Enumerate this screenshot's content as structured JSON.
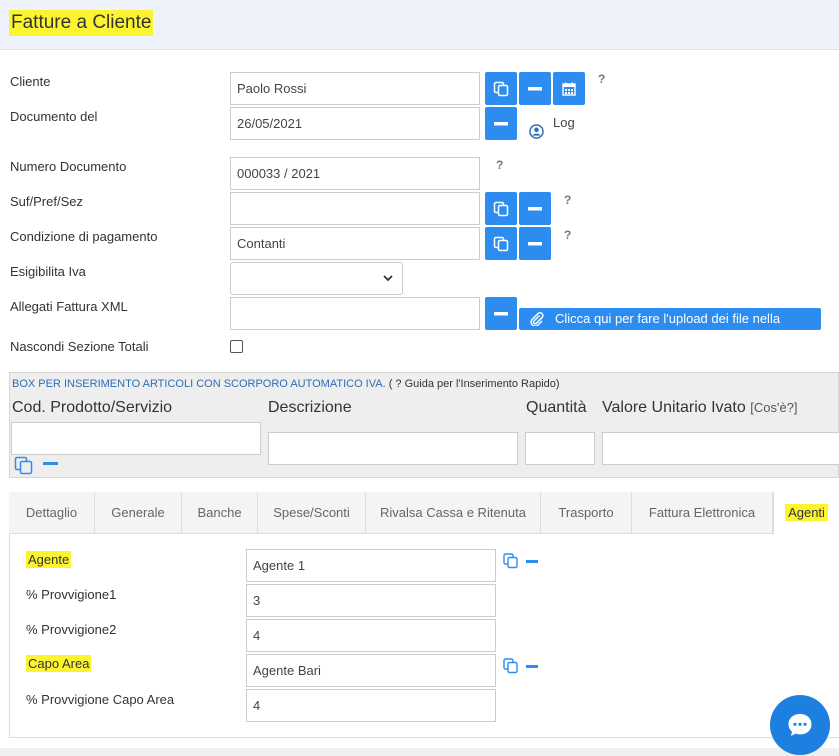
{
  "page_title": "Fatture a Cliente",
  "form": {
    "cliente": {
      "label": "Cliente",
      "value": "Paolo Rossi"
    },
    "documento_del": {
      "label": "Documento del",
      "value": "26/05/2021",
      "log_label": "Log"
    },
    "numero_documento": {
      "label": "Numero Documento",
      "value": "000033 / 2021"
    },
    "suf_pref_sez": {
      "label": "Suf/Pref/Sez",
      "value": ""
    },
    "condizione_pagamento": {
      "label": "Condizione di pagamento",
      "value": "Contanti"
    },
    "esigibilita_iva": {
      "label": "Esigibilita Iva",
      "value": ""
    },
    "allegati_xml": {
      "label": "Allegati Fattura XML",
      "value": "",
      "upload_label": "Clicca qui per fare l'upload dei file nella cartella"
    },
    "nascondi_totali": {
      "label": "Nascondi Sezione Totali",
      "checked": false
    },
    "help_mark": "?"
  },
  "articoli_box": {
    "heading_blue": "BOX PER INSERIMENTO ARTICOLI CON SCORPORO AUTOMATICO IVA.",
    "heading_tail": " ( ? Guida per l'Inserimento Rapido)",
    "columns": {
      "codice": "Cod. Prodotto/Servizio",
      "descrizione": "Descrizione",
      "quantita": "Quantità",
      "valore": "Valore Unitario Ivato",
      "valore_help": "[Cos'è?]"
    }
  },
  "tabs": [
    {
      "label": "Dettaglio"
    },
    {
      "label": "Generale"
    },
    {
      "label": "Banche"
    },
    {
      "label": "Spese/Sconti"
    },
    {
      "label": "Rivalsa Cassa e Ritenuta"
    },
    {
      "label": "Trasporto"
    },
    {
      "label": "Fattura Elettronica"
    },
    {
      "label": "Agenti"
    }
  ],
  "active_tab": "Agenti",
  "agenti": {
    "agente": {
      "label": "Agente",
      "value": "Agente 1"
    },
    "provvigione1": {
      "label": "% Provvigione1",
      "value": "3"
    },
    "provvigione2": {
      "label": "% Provvigione2",
      "value": "4"
    },
    "capo_area": {
      "label": "Capo Area",
      "value": "Agente Bari"
    },
    "provvigione_capo_area": {
      "label": "% Provvigione Capo Area",
      "value": "4"
    }
  },
  "colors": {
    "accent": "#2d8cf0",
    "highlight": "#fdf431",
    "header_bg": "#eef3fb"
  }
}
